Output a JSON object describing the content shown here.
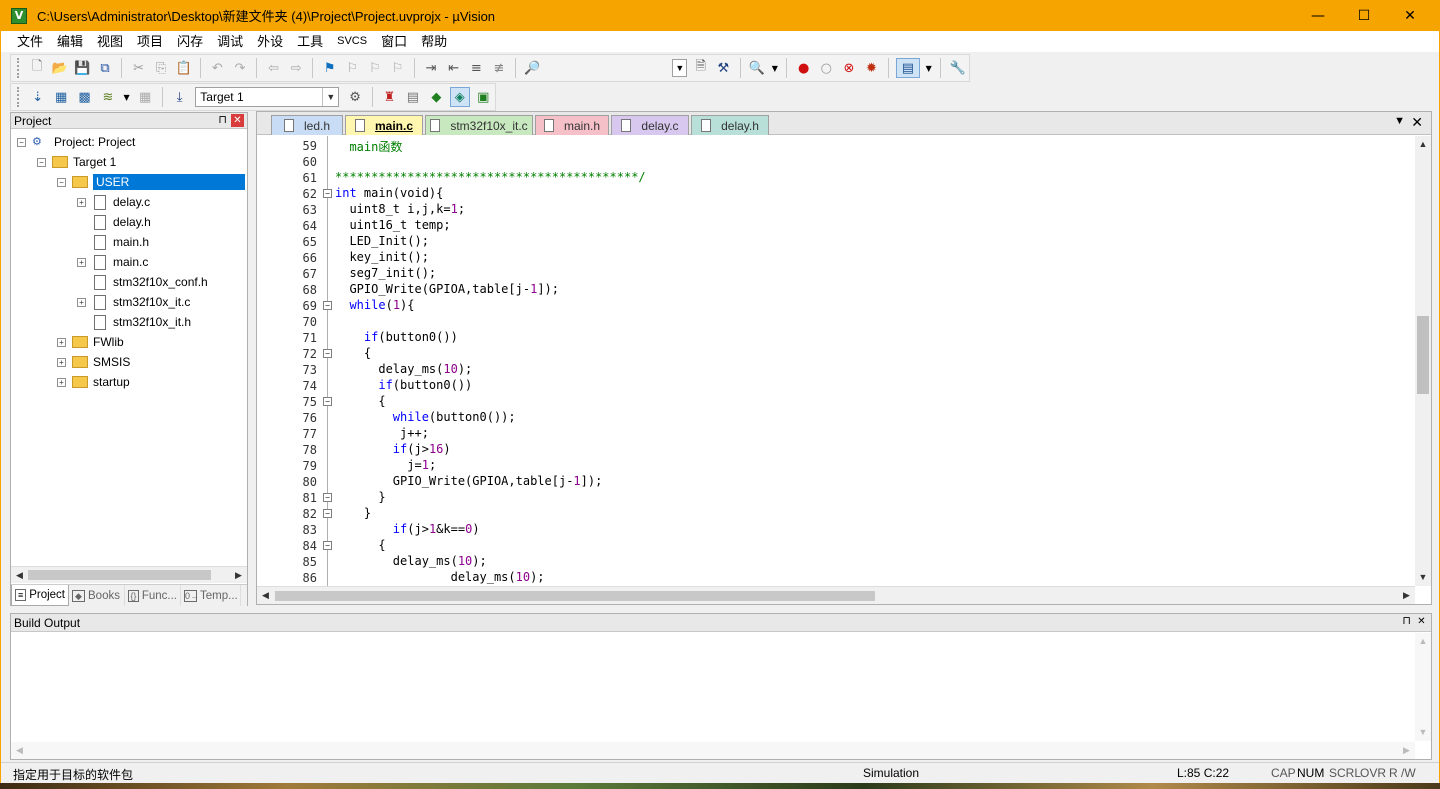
{
  "window": {
    "title": "C:\\Users\\Administrator\\Desktop\\新建文件夹 (4)\\Project\\Project.uvprojx - µVision",
    "app_icon_letter": "V",
    "minimize": "—",
    "maximize": "☐",
    "close": "✕"
  },
  "menu": [
    "文件",
    "编辑",
    "视图",
    "项目",
    "闪存",
    "调试",
    "外设",
    "工具",
    "SVCS",
    "窗口",
    "帮助"
  ],
  "toolbar": {
    "target_select": "Target 1"
  },
  "project_panel": {
    "title": "Project",
    "pin": "⊓",
    "close": "✕",
    "tree": [
      {
        "label": "Project: Project",
        "kind": "project",
        "expander": "−"
      },
      {
        "label": "Target 1",
        "kind": "target",
        "expander": "−"
      },
      {
        "label": "USER",
        "kind": "folder",
        "expander": "−",
        "selected": true
      },
      {
        "label": "delay.c",
        "kind": "file",
        "expander": "+"
      },
      {
        "label": "delay.h",
        "kind": "file",
        "expander": ""
      },
      {
        "label": "main.h",
        "kind": "file",
        "expander": ""
      },
      {
        "label": "main.c",
        "kind": "file",
        "expander": "+"
      },
      {
        "label": "stm32f10x_conf.h",
        "kind": "file",
        "expander": ""
      },
      {
        "label": "stm32f10x_it.c",
        "kind": "file",
        "expander": "+"
      },
      {
        "label": "stm32f10x_it.h",
        "kind": "file",
        "expander": ""
      },
      {
        "label": "FWlib",
        "kind": "folder",
        "expander": "+"
      },
      {
        "label": "SMSIS",
        "kind": "folder",
        "expander": "+"
      },
      {
        "label": "startup",
        "kind": "folder",
        "expander": "+"
      }
    ],
    "tabs": [
      {
        "label": "Project",
        "icon": "≡",
        "active": true
      },
      {
        "label": "Books",
        "icon": "◆",
        "active": false
      },
      {
        "label": "Func...",
        "icon": "{}",
        "active": false
      },
      {
        "label": "Temp...",
        "icon": "0→",
        "active": false
      }
    ]
  },
  "editor": {
    "tabs": [
      {
        "label": "led.h",
        "active": false,
        "color": "#c8ddf5"
      },
      {
        "label": "main.c",
        "active": true,
        "color": "#fff7b0"
      },
      {
        "label": "stm32f10x_it.c",
        "active": false,
        "color": "#c8e8c0"
      },
      {
        "label": "main.h",
        "active": false,
        "color": "#f5c0c8"
      },
      {
        "label": "delay.c",
        "active": false,
        "color": "#d8c8f0"
      },
      {
        "label": "delay.h",
        "active": false,
        "color": "#b8e0d8"
      }
    ],
    "tab_menu": "▼",
    "tab_close": "✕",
    "lines": [
      {
        "n": "59",
        "fold": "",
        "segs": [
          [
            "cm",
            "  main函数"
          ]
        ]
      },
      {
        "n": "60",
        "fold": "",
        "segs": [
          [
            "cm",
            ""
          ]
        ]
      },
      {
        "n": "61",
        "fold": "",
        "segs": [
          [
            "cm",
            "******************************************/"
          ]
        ]
      },
      {
        "n": "62",
        "fold": "−",
        "segs": [
          [
            "kw",
            "int"
          ],
          [
            "tx",
            " main(void)"
          ],
          [
            "tx",
            "{"
          ]
        ]
      },
      {
        "n": "63",
        "fold": "",
        "segs": [
          [
            "tx",
            "  uint8_t i,j,k="
          ],
          [
            "nm",
            "1"
          ],
          [
            "tx",
            ";"
          ]
        ]
      },
      {
        "n": "64",
        "fold": "",
        "segs": [
          [
            "tx",
            "  uint16_t temp;"
          ]
        ]
      },
      {
        "n": "65",
        "fold": "",
        "segs": [
          [
            "tx",
            "  LED_Init();"
          ]
        ]
      },
      {
        "n": "66",
        "fold": "",
        "segs": [
          [
            "tx",
            "  key_init();"
          ]
        ]
      },
      {
        "n": "67",
        "fold": "",
        "segs": [
          [
            "tx",
            "  seg7_init();"
          ]
        ]
      },
      {
        "n": "68",
        "fold": "",
        "segs": [
          [
            "tx",
            "  GPIO_Write(GPIOA,table[j-"
          ],
          [
            "nm",
            "1"
          ],
          [
            "tx",
            "]);"
          ]
        ]
      },
      {
        "n": "69",
        "fold": "−",
        "segs": [
          [
            "kw",
            "  while"
          ],
          [
            "tx",
            "("
          ],
          [
            "nm",
            "1"
          ],
          [
            "tx",
            "){"
          ]
        ]
      },
      {
        "n": "70",
        "fold": "",
        "segs": [
          [
            "tx",
            ""
          ]
        ]
      },
      {
        "n": "71",
        "fold": "",
        "segs": [
          [
            "kw",
            "    if"
          ],
          [
            "tx",
            "(button0())"
          ]
        ]
      },
      {
        "n": "72",
        "fold": "−",
        "segs": [
          [
            "tx",
            "    {"
          ]
        ]
      },
      {
        "n": "73",
        "fold": "",
        "segs": [
          [
            "tx",
            "      delay_ms("
          ],
          [
            "nm",
            "10"
          ],
          [
            "tx",
            ");"
          ]
        ]
      },
      {
        "n": "74",
        "fold": "",
        "segs": [
          [
            "kw",
            "      if"
          ],
          [
            "tx",
            "(button0())"
          ]
        ]
      },
      {
        "n": "75",
        "fold": "−",
        "segs": [
          [
            "tx",
            "      {"
          ]
        ]
      },
      {
        "n": "76",
        "fold": "",
        "segs": [
          [
            "kw",
            "        while"
          ],
          [
            "tx",
            "(button0());"
          ]
        ]
      },
      {
        "n": "77",
        "fold": "",
        "segs": [
          [
            "tx",
            "         j++;"
          ]
        ]
      },
      {
        "n": "78",
        "fold": "",
        "segs": [
          [
            "kw",
            "        if"
          ],
          [
            "tx",
            "(j>"
          ],
          [
            "nm",
            "16"
          ],
          [
            "tx",
            ")"
          ]
        ]
      },
      {
        "n": "79",
        "fold": "",
        "segs": [
          [
            "tx",
            "          j="
          ],
          [
            "nm",
            "1"
          ],
          [
            "tx",
            ";"
          ]
        ]
      },
      {
        "n": "80",
        "fold": "",
        "segs": [
          [
            "tx",
            "        GPIO_Write(GPIOA,table[j-"
          ],
          [
            "nm",
            "1"
          ],
          [
            "tx",
            "]);"
          ]
        ]
      },
      {
        "n": "81",
        "fold": "−",
        "segs": [
          [
            "tx",
            "      }"
          ]
        ]
      },
      {
        "n": "82",
        "fold": "−",
        "segs": [
          [
            "tx",
            "    }"
          ]
        ]
      },
      {
        "n": "83",
        "fold": "",
        "segs": [
          [
            "kw",
            "        if"
          ],
          [
            "tx",
            "(j>"
          ],
          [
            "nm",
            "1"
          ],
          [
            "tx",
            "&k=="
          ],
          [
            "nm",
            "0"
          ],
          [
            "tx",
            ")"
          ]
        ]
      },
      {
        "n": "84",
        "fold": "−",
        "segs": [
          [
            "tx",
            "      {"
          ]
        ]
      },
      {
        "n": "85",
        "fold": "",
        "segs": [
          [
            "tx",
            "        delay_ms("
          ],
          [
            "nm",
            "10"
          ],
          [
            "tx",
            ");"
          ]
        ]
      },
      {
        "n": "86",
        "fold": "",
        "segs": [
          [
            "tx",
            "                delay_ms("
          ],
          [
            "nm",
            "10"
          ],
          [
            "tx",
            ");"
          ]
        ]
      }
    ]
  },
  "build_output": {
    "title": "Build Output",
    "pin": "⊓",
    "close": "✕"
  },
  "status": {
    "message": "指定用于目标的软件包",
    "mode": "Simulation",
    "position": "L:85 C:22",
    "keys": [
      {
        "label": "CAP",
        "on": false
      },
      {
        "label": "NUM",
        "on": true
      },
      {
        "label": "SCRL",
        "on": false
      },
      {
        "label": "OVR",
        "on": false
      },
      {
        "label": "R /W",
        "on": false
      }
    ]
  }
}
